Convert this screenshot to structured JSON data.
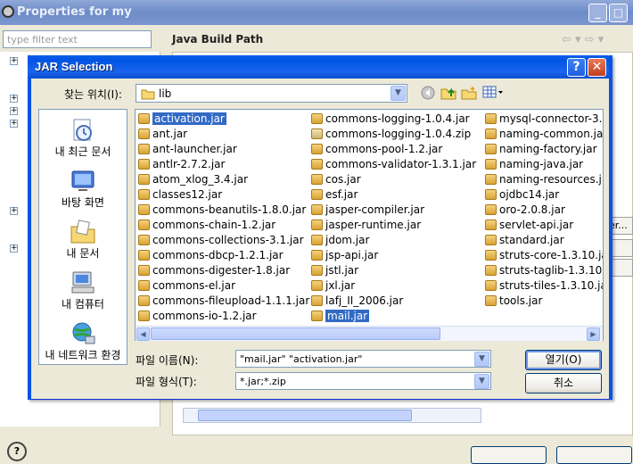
{
  "bg_window": {
    "title": "Properties for my",
    "filter_placeholder": "type filter text",
    "panel_title": "Java Build Path",
    "side_button_text": "er...",
    "help_glyph": "?"
  },
  "dialog": {
    "title": "JAR Selection",
    "look_in_label": "찾는 위치(I):",
    "look_in_value": "lib",
    "places": [
      {
        "label": "내 최근 문서",
        "icon": "recent-documents-icon"
      },
      {
        "label": "바탕 화면",
        "icon": "desktop-icon"
      },
      {
        "label": "내 문서",
        "icon": "my-documents-icon"
      },
      {
        "label": "내 컴퓨터",
        "icon": "my-computer-icon"
      },
      {
        "label": "내 네트워크 환경",
        "icon": "network-icon"
      }
    ],
    "files": {
      "col1": [
        {
          "name": "activation.jar",
          "selected": true
        },
        {
          "name": "ant.jar"
        },
        {
          "name": "ant-launcher.jar"
        },
        {
          "name": "antlr-2.7.2.jar"
        },
        {
          "name": "atom_xlog_3.4.jar"
        },
        {
          "name": "classes12.jar"
        },
        {
          "name": "commons-beanutils-1.8.0.jar"
        },
        {
          "name": "commons-chain-1.2.jar"
        },
        {
          "name": "commons-collections-3.1.jar"
        },
        {
          "name": "commons-dbcp-1.2.1.jar"
        },
        {
          "name": "commons-digester-1.8.jar"
        },
        {
          "name": "commons-el.jar"
        },
        {
          "name": "commons-fileupload-1.1.1.jar"
        },
        {
          "name": "commons-io-1.2.jar"
        }
      ],
      "col2": [
        {
          "name": "commons-logging-1.0.4.jar"
        },
        {
          "name": "commons-logging-1.0.4.zip",
          "zip": true
        },
        {
          "name": "commons-pool-1.2.jar"
        },
        {
          "name": "commons-validator-1.3.1.jar"
        },
        {
          "name": "cos.jar"
        },
        {
          "name": "esf.jar"
        },
        {
          "name": "jasper-compiler.jar"
        },
        {
          "name": "jasper-runtime.jar"
        },
        {
          "name": "jdom.jar"
        },
        {
          "name": "jsp-api.jar"
        },
        {
          "name": "jstl.jar"
        },
        {
          "name": "jxl.jar"
        },
        {
          "name": "lafj_II_2006.jar"
        },
        {
          "name": "mail.jar",
          "selected": true
        }
      ],
      "col3": [
        {
          "name": "mysql-connector-3."
        },
        {
          "name": "naming-common.ja"
        },
        {
          "name": "naming-factory.jar"
        },
        {
          "name": "naming-java.jar"
        },
        {
          "name": "naming-resources.j"
        },
        {
          "name": "ojdbc14.jar"
        },
        {
          "name": "oro-2.0.8.jar"
        },
        {
          "name": "servlet-api.jar"
        },
        {
          "name": "standard.jar"
        },
        {
          "name": "struts-core-1.3.10.ja"
        },
        {
          "name": "struts-taglib-1.3.10.j"
        },
        {
          "name": "struts-tiles-1.3.10.ja"
        },
        {
          "name": "tools.jar"
        }
      ]
    },
    "file_name_label": "파일 이름(N):",
    "file_name_value": "\"mail.jar\" \"activation.jar\"",
    "file_type_label": "파일 형식(T):",
    "file_type_value": "*.jar;*.zip",
    "open_button": "열기(O)",
    "cancel_button": "취소",
    "colors": {
      "titlebar": "#0054e3",
      "selection": "#316ac5"
    }
  }
}
